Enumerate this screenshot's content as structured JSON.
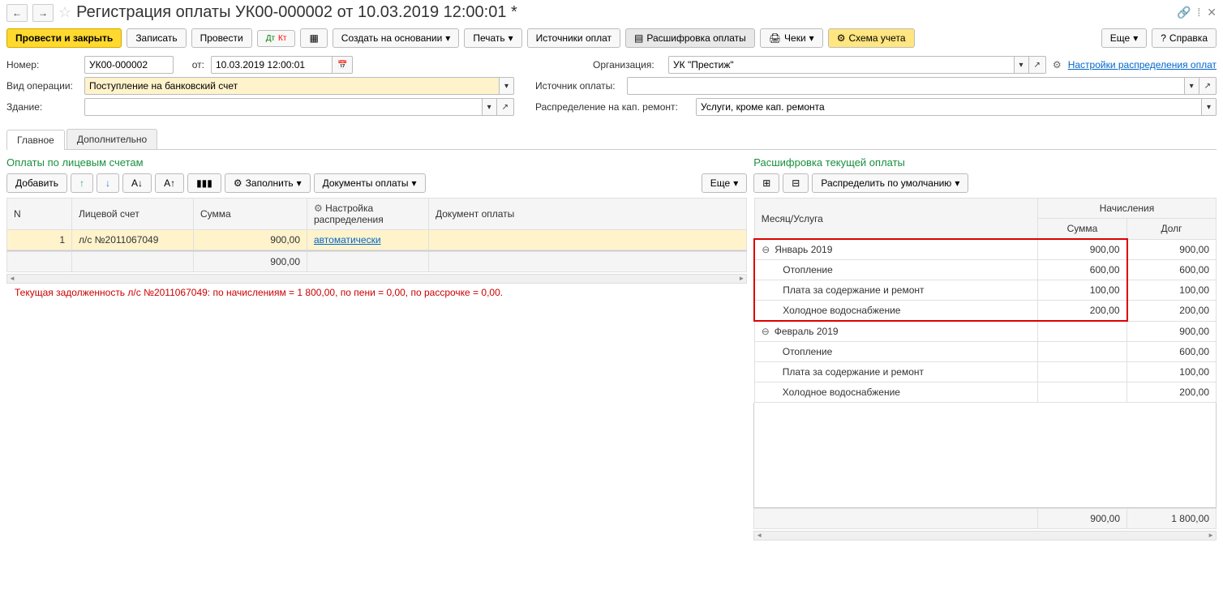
{
  "title": "Регистрация оплаты УК00-000002 от 10.03.2019 12:00:01 *",
  "toolbar": {
    "post_close": "Провести и закрыть",
    "save": "Записать",
    "post": "Провести",
    "create_based": "Создать на основании",
    "print": "Печать",
    "payment_sources": "Источники оплат",
    "payment_breakdown": "Расшифровка оплаты",
    "checks": "Чеки",
    "scheme": "Схема учета",
    "more": "Еще",
    "help": "Справка"
  },
  "form": {
    "number_label": "Номер:",
    "number": "УК00-000002",
    "from_label": "от:",
    "date": "10.03.2019 12:00:01",
    "org_label": "Организация:",
    "org": "УК \"Престиж\"",
    "settings_link": "Настройки распределения оплат",
    "op_type_label": "Вид операции:",
    "op_type": "Поступление на банковский счет",
    "source_label": "Источник оплаты:",
    "building_label": "Здание:",
    "dist_label": "Распределение на кап. ремонт:",
    "dist": "Услуги, кроме кап. ремонта"
  },
  "tabs": {
    "main": "Главное",
    "extra": "Дополнительно"
  },
  "left": {
    "title": "Оплаты по лицевым счетам",
    "add": "Добавить",
    "fill": "Заполнить",
    "pay_docs": "Документы оплаты",
    "more": "Еще",
    "cols": {
      "n": "N",
      "acc": "Лицевой счет",
      "sum": "Сумма",
      "dist": "Настройка распределения",
      "doc": "Документ оплаты"
    },
    "rows": [
      {
        "n": "1",
        "acc": "л/с №2011067049",
        "sum": "900,00",
        "dist": "автоматически"
      }
    ],
    "total": "900,00"
  },
  "right": {
    "title": "Расшифровка текущей оплаты",
    "dist_default": "Распределить по умолчанию",
    "cols": {
      "month": "Месяц/Услуга",
      "accr": "Начисления",
      "sum": "Сумма",
      "debt": "Долг"
    },
    "rows": [
      {
        "label": "Январь 2019",
        "sum": "900,00",
        "debt": "900,00",
        "level": 0,
        "hl": true
      },
      {
        "label": "Отопление",
        "sum": "600,00",
        "debt": "600,00",
        "level": 1,
        "hl": true
      },
      {
        "label": "Плата за содержание и ремонт",
        "sum": "100,00",
        "debt": "100,00",
        "level": 1,
        "hl": true
      },
      {
        "label": "Холодное водоснабжение",
        "sum": "200,00",
        "debt": "200,00",
        "level": 1,
        "hl": true
      },
      {
        "label": "Февраль 2019",
        "sum": "",
        "debt": "900,00",
        "level": 0,
        "hl": false
      },
      {
        "label": "Отопление",
        "sum": "",
        "debt": "600,00",
        "level": 1,
        "hl": false
      },
      {
        "label": "Плата за содержание и ремонт",
        "sum": "",
        "debt": "100,00",
        "level": 1,
        "hl": false
      },
      {
        "label": "Холодное водоснабжение",
        "sum": "",
        "debt": "200,00",
        "level": 1,
        "hl": false
      }
    ],
    "total_sum": "900,00",
    "total_debt": "1 800,00"
  },
  "status": "Текущая задолженность л/с №2011067049: по начислениям = 1 800,00, по пени = 0,00, по рассрочке = 0,00."
}
